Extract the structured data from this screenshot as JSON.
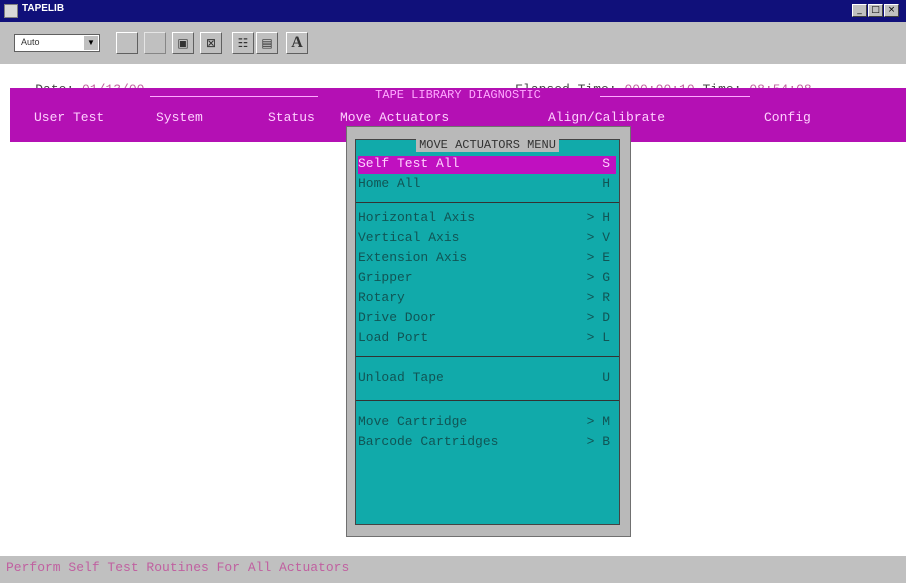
{
  "window": {
    "title": "TAPELIB",
    "controls": [
      "minimize",
      "maximize",
      "close"
    ],
    "control_glyphs": {
      "minimize": "_",
      "maximize": "□",
      "close": "×"
    }
  },
  "toolbar": {
    "font_select_value": "Auto",
    "font_button_label": "A"
  },
  "header": {
    "date_label": "Date:",
    "date_value": "01/13/00",
    "elapsed_label": "Elapsed Time:",
    "elapsed_value": "000:00:10",
    "time_label": "Time:",
    "time_value": "08:54:08"
  },
  "main_menu": {
    "title": "TAPE LIBRARY DIAGNOSTIC",
    "items": [
      "User Test",
      "System",
      "Status",
      "Move Actuators",
      "Align/Calibrate",
      "Config"
    ]
  },
  "popup": {
    "title": "MOVE ACTUATORS MENU",
    "groups": [
      [
        {
          "label": "Self Test All",
          "key": "S",
          "selected": true
        },
        {
          "label": "Home All",
          "key": "H"
        }
      ],
      [
        {
          "label": "Horizontal Axis",
          "key": "> H"
        },
        {
          "label": "Vertical Axis",
          "key": "> V"
        },
        {
          "label": "Extension Axis",
          "key": "> E"
        },
        {
          "label": "Gripper",
          "key": "> G"
        },
        {
          "label": "Rotary",
          "key": "> R"
        },
        {
          "label": "Drive Door",
          "key": "> D"
        },
        {
          "label": "Load Port",
          "key": "> L"
        }
      ],
      [
        {
          "label": "Unload Tape",
          "key": "U"
        }
      ],
      [
        {
          "label": "Move Cartridge",
          "key": "> M"
        },
        {
          "label": "Barcode Cartridges",
          "key": "> B"
        }
      ]
    ]
  },
  "status": {
    "message": "Perform Self Test Routines For All Actuators"
  },
  "colors": {
    "titlebar": "#10107a",
    "menu_bar": "#b410b4",
    "popup_bg": "#11aaaa",
    "selection": "#c010c0"
  }
}
